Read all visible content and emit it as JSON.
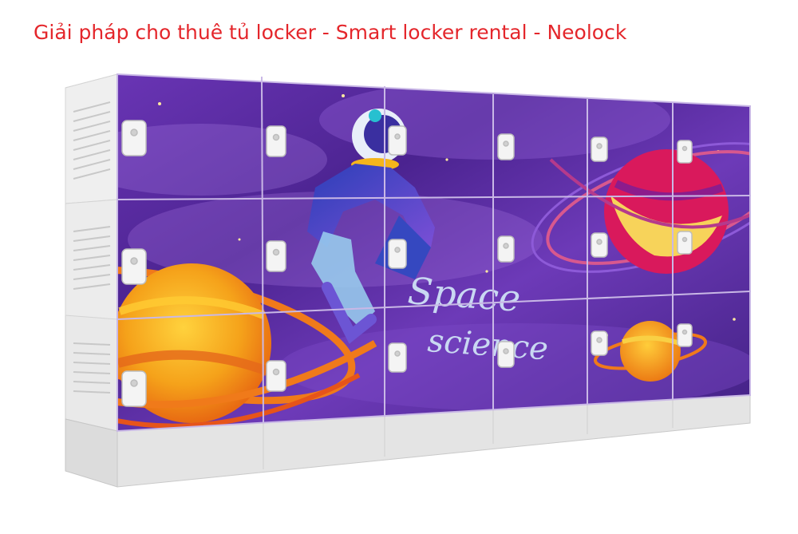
{
  "caption": "Giải pháp cho thuê tủ locker - Smart locker rental - Neolock",
  "colors": {
    "caption": "#e4262b",
    "panel_purple": "#5a2a9a",
    "panel_violet": "#7c3fc0",
    "planet_orange": "#f07a1a",
    "planet_yellow": "#f5b51c",
    "frame_gray": "#e6e6e6",
    "lock_white": "#f4f4f4"
  },
  "artwork": {
    "line1": "Space",
    "line2": "science"
  },
  "locker": {
    "columns": 6,
    "rows": 3,
    "side_unit": "vented-control-cabinet"
  },
  "icons": [
    "astronaut-graphic",
    "ringed-planet-graphic",
    "lock-icon"
  ]
}
